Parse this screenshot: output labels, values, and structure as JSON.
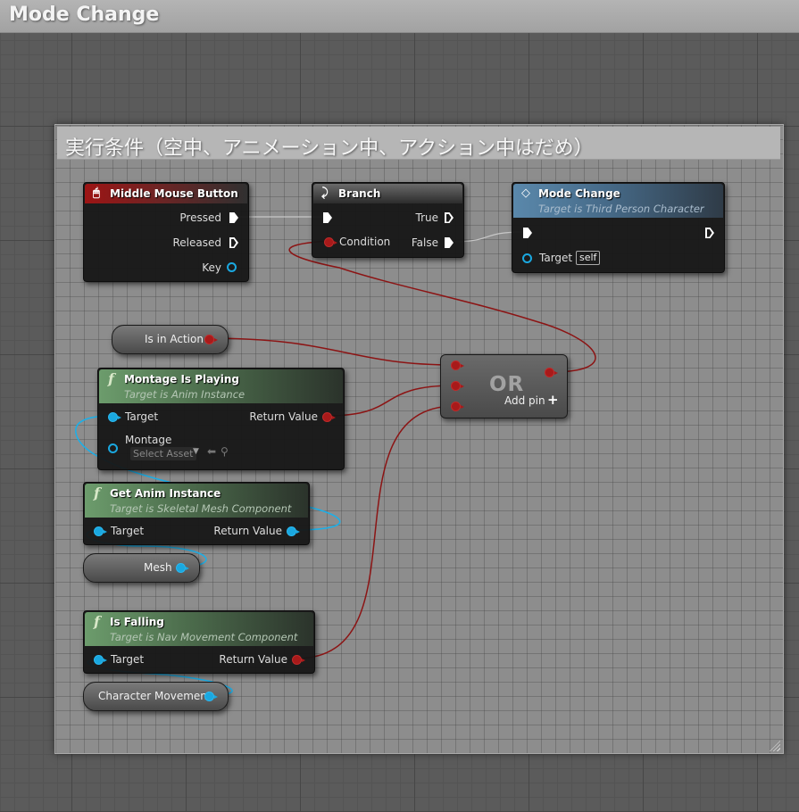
{
  "window": {
    "title": "Mode Change"
  },
  "comment": {
    "text": "実行条件（空中、アニメーション中、アクション中はだめ）"
  },
  "nodes": {
    "middle_mouse": {
      "title": "Middle Mouse Button",
      "pins": [
        "Pressed",
        "Released",
        "Key"
      ]
    },
    "branch": {
      "title": "Branch",
      "pins": {
        "condition": "Condition",
        "true": "True",
        "false": "False"
      }
    },
    "mode_change": {
      "title": "Mode Change",
      "subtitle": "Target is Third Person Character",
      "target": "Target",
      "self": "self"
    },
    "is_in_action": {
      "label": "Is in Action"
    },
    "or": {
      "label": "OR",
      "add_pin": "Add pin"
    },
    "montage": {
      "title": "Montage Is Playing",
      "subtitle": "Target is Anim Instance",
      "target": "Target",
      "return": "Return Value",
      "montage": "Montage",
      "select": "Select Asset"
    },
    "get_anim": {
      "title": "Get Anim Instance",
      "subtitle": "Target is Skeletal Mesh Component",
      "target": "Target",
      "return": "Return Value"
    },
    "mesh": {
      "label": "Mesh"
    },
    "is_falling": {
      "title": "Is Falling",
      "subtitle": "Target is Nav Movement Component",
      "target": "Target",
      "return": "Return Value"
    },
    "char_move": {
      "label": "Character Movement"
    }
  },
  "colors": {
    "bool_wire": "#8c1414",
    "object_wire": "#1ab0ea",
    "exec_wire": "#c8c8c8"
  }
}
